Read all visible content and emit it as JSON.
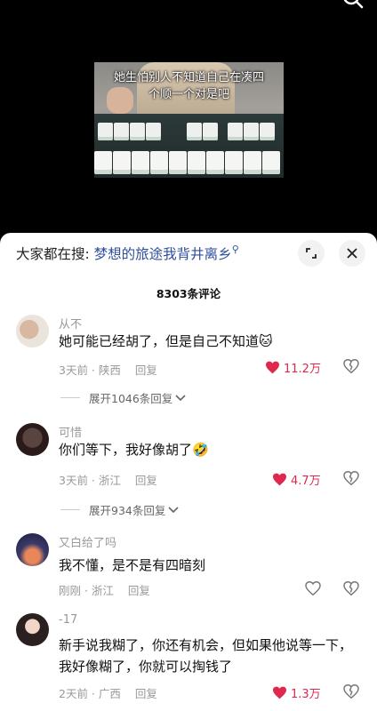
{
  "video": {
    "caption_line1": "她生怕别人不知道自己在凑四",
    "caption_line2": "个顺一个对是吧"
  },
  "search": {
    "prefix": "大家都在搜:",
    "keyword": "梦想的旅途我背井离乡"
  },
  "comments_count": "8303条评论",
  "comments": [
    {
      "user": "从不",
      "text": "她可能已经胡了，但是自己不知道",
      "emoji": "🐱",
      "time": "3天前 · 陕西",
      "reply": "回复",
      "likes": "11.2万",
      "liked": true,
      "expand": "展开1046条回复"
    },
    {
      "user": "可惜",
      "text": "你们等下，我好像胡了",
      "emoji": "🤣",
      "time": "3天前 · 浙江",
      "reply": "回复",
      "likes": "4.7万",
      "liked": true,
      "expand": "展开934条回复"
    },
    {
      "user": "又白给了吗",
      "text": "我不懂，是不是有四暗刻",
      "time": "刚刚 · 浙江",
      "reply": "回复",
      "likes": "",
      "liked": false
    },
    {
      "user": "-17",
      "text": "新手说我糊了，你还有机会，但如果他说等一下，我好像糊了，你就可以掏钱了",
      "time": "2天前 · 广西",
      "reply": "回复",
      "likes": "1.3万",
      "liked": true
    }
  ],
  "icons": {
    "like": "heart-icon",
    "dislike": "broken-heart-icon",
    "expand": "chevron-down-icon",
    "close": "close-icon",
    "collapse": "collapse-icon",
    "search": "search-icon"
  },
  "colors": {
    "like_active": "#e0284f",
    "keyword": "#2f4f9b",
    "muted": "#999999"
  }
}
